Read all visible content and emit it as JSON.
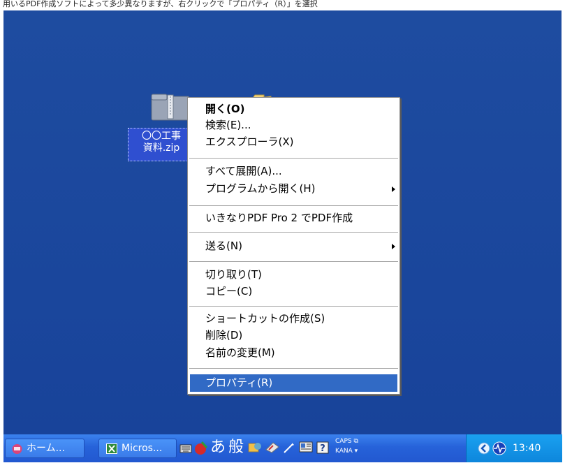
{
  "top_strip_text": "用いるPDF作成ソフトによって多少異なりますが、右クリックで「プロパティ（R）」を選択",
  "desktop": {
    "icons": [
      {
        "label_line1": "〇〇工事",
        "label_line2": "資料.zip"
      }
    ]
  },
  "context_menu": {
    "items": [
      {
        "label": "開く(O)"
      },
      {
        "label": "検索(E)..."
      },
      {
        "label": "エクスプローラ(X)"
      },
      {
        "label": "すべて展開(A)..."
      },
      {
        "label": "プログラムから開く(H)"
      },
      {
        "label": "いきなりPDF Pro 2 でPDF作成"
      },
      {
        "label": "送る(N)"
      },
      {
        "label": "切り取り(T)"
      },
      {
        "label": "コピー(C)"
      },
      {
        "label": "ショートカットの作成(S)"
      },
      {
        "label": "削除(D)"
      },
      {
        "label": "名前の変更(M)"
      },
      {
        "label": "プロパティ(R)"
      }
    ]
  },
  "taskbar": {
    "start_label": "ホーム...",
    "task_label": "Micros...",
    "ime_mode": "あ",
    "ime_dict": "般",
    "caps_label": "CAPS",
    "kana_label": "KANA",
    "clock": "13:40"
  },
  "colors": {
    "desktop": "#1e4ca0",
    "highlight": "#316ac5",
    "taskbar": "#2662d9",
    "tray": "#1aa1f0"
  }
}
